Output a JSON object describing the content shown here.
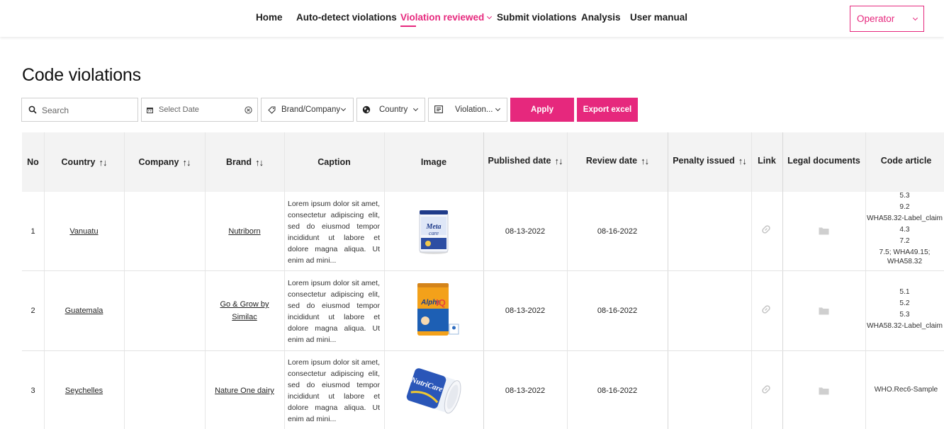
{
  "nav": {
    "items": [
      "Home",
      "Auto-detect violations",
      "Violation reviewed",
      "Submit violations",
      "Analysis",
      "User manual"
    ],
    "active": "Violation reviewed",
    "role": "Operator",
    "accent": "#e6287d"
  },
  "page": {
    "title": "Code violations"
  },
  "filters": {
    "search_placeholder": "Search",
    "date_placeholder": "Select Date",
    "brand": "Brand/Company",
    "country": "Country",
    "violation": "Violation...",
    "apply": "Apply",
    "export": "Export excel"
  },
  "table": {
    "headers": {
      "no": "No",
      "country": "Country",
      "company": "Company",
      "brand": "Brand",
      "caption": "Caption",
      "image": "Image",
      "published": "Published date",
      "review": "Review date",
      "penalty": "Penalty issued",
      "link": "Link",
      "legal": "Legal documents",
      "code": "Code article"
    },
    "sort_glyph": "↑↓",
    "rows": [
      {
        "no": "1",
        "country": "Vanuatu",
        "company": "",
        "brand": "Nutriborn",
        "caption": "Lorem ipsum dolor sit amet, consectetur adipiscing elit, sed do eiusmod tempor incididunt ut labore et dolore magna aliqua. Ut enim ad mini...",
        "image": "Meta care formula can",
        "published": "08-13-2022",
        "review": "08-16-2022",
        "penalty": "",
        "codes": [
          "5.3",
          "9.2",
          "WHA58.32-Label_claim",
          "4.3",
          "7.2",
          "7.5; WHA49.15;",
          "WHA58.32"
        ]
      },
      {
        "no": "2",
        "country": "Guatemala",
        "company": "",
        "brand": "Go & Grow by Similac",
        "caption": "Lorem ipsum dolor sit amet, consectetur adipiscing elit, sed do eiusmod tempor incididunt ut labore et dolore magna aliqua. Ut enim ad mini...",
        "image": "Alpha IQ formula can",
        "published": "08-13-2022",
        "review": "08-16-2022",
        "penalty": "",
        "codes": [
          "5.1",
          "5.2",
          "5.3",
          "WHA58.32-Label_claim"
        ]
      },
      {
        "no": "3",
        "country": "Seychelles",
        "company": "",
        "brand": "Nature One dairy",
        "caption": "Lorem ipsum dolor sit amet, consectetur adipiscing elit, sed do eiusmod tempor incididunt ut labore et dolore magna aliqua. Ut enim ad mini...",
        "image": "NutriCare formula can",
        "published": "08-13-2022",
        "review": "08-16-2022",
        "penalty": "",
        "codes": [
          "WHO.Rec6-Sample"
        ]
      }
    ]
  }
}
